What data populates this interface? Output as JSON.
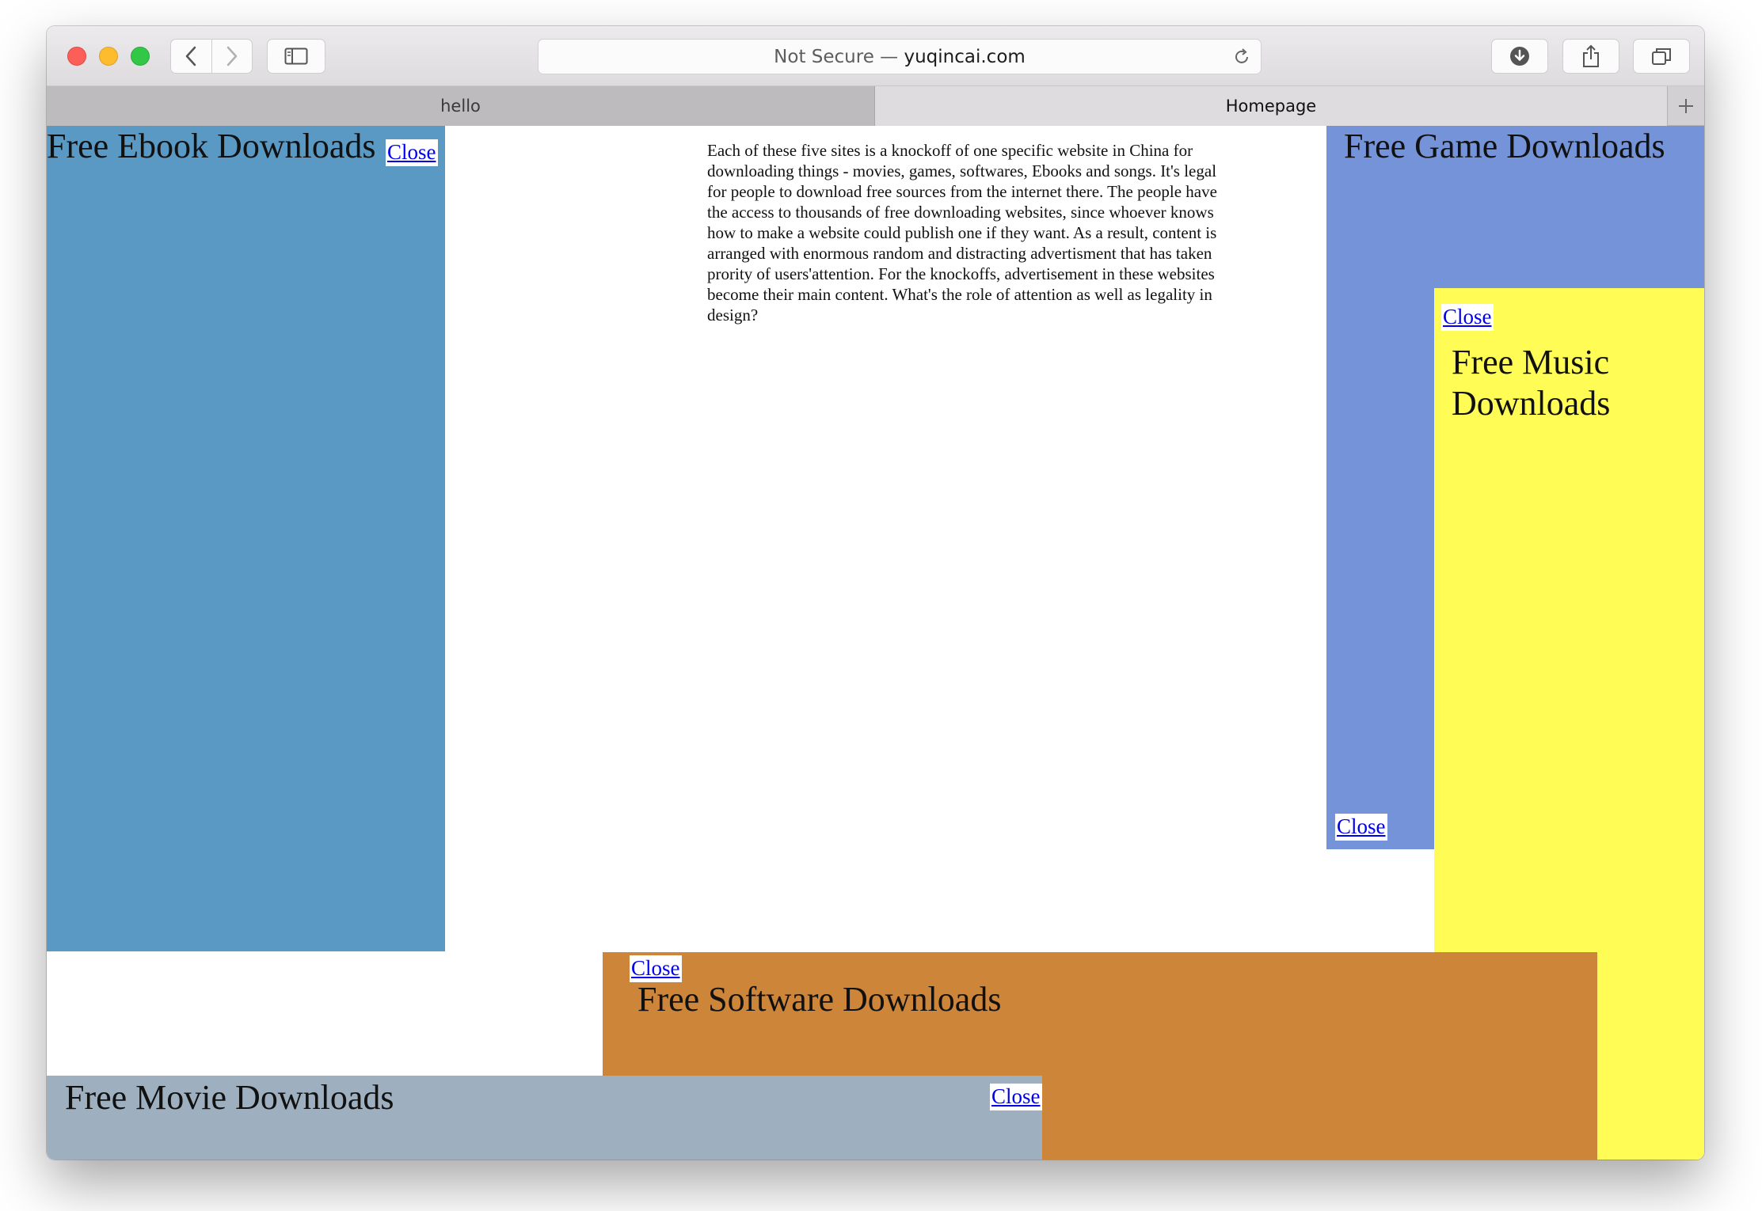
{
  "browser": {
    "address": {
      "prefix": "Not Secure —",
      "domain": "yuqincai.com"
    },
    "tabs": [
      {
        "label": "hello",
        "active": false
      },
      {
        "label": "Homepage",
        "active": true
      }
    ],
    "icons": {
      "back": "chevron-left-icon",
      "forward": "chevron-right-icon",
      "sidebar": "sidebar-icon",
      "reload": "reload-icon",
      "downloads": "download-icon",
      "share": "share-icon",
      "tabs": "tabs-overview-icon",
      "new_tab": "plus-icon"
    }
  },
  "page": {
    "intro_text": "Each of these five sites is a knockoff of one specific website in China for downloading things - movies, games, softwares, Ebooks and songs. It's legal for people to download free sources from the internet there. The people have the access to thousands of free downloading websites, since whoever knows how to make a website could publish one if they want. As a result, content is arranged with enormous random and distracting advertisment that has taken prority of users'attention. For the knockoffs, advertisement in these websites become their main content. What's the role of attention as well as legality in design?",
    "panels": {
      "ebook": {
        "title": "Free Ebook Downloads",
        "close": "Close",
        "color": "#5a99c4"
      },
      "game": {
        "title": "Free Game Downloads",
        "close": "Close",
        "color": "#7593d8"
      },
      "music": {
        "title": "Free Music Downloads",
        "close": "Close",
        "color": "#fffd55"
      },
      "software": {
        "title": "Free Software Downloads",
        "close": "Close",
        "color": "#cd853a"
      },
      "movie": {
        "title": "Free Movie Downloads",
        "close": "Close",
        "color": "#9eb0bf"
      }
    }
  }
}
